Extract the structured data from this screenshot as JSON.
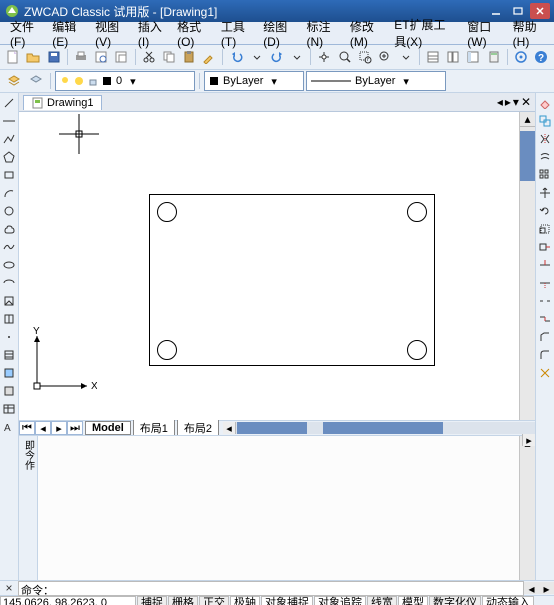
{
  "title": "ZWCAD Classic 试用版 - [Drawing1]",
  "menu": [
    "文件(F)",
    "编辑(E)",
    "视图(V)",
    "插入(I)",
    "格式(O)",
    "工具(T)",
    "绘图(D)",
    "标注(N)",
    "修改(M)",
    "ET扩展工具(X)",
    "窗口(W)",
    "帮助(H)"
  ],
  "doc_tab": "Drawing1",
  "layer_combo": "0",
  "color_combo": "ByLayer",
  "linetype_combo": "ByLayer",
  "model_tabs": {
    "active": "Model",
    "others": [
      "布局1",
      "布局2"
    ]
  },
  "cmd_prompt": "命令：",
  "coords": "145.0626,  98.2623,  0",
  "status_cells": [
    {
      "t": "捕捉",
      "on": false
    },
    {
      "t": "栅格",
      "on": false
    },
    {
      "t": "正交",
      "on": false
    },
    {
      "t": "极轴",
      "on": true
    },
    {
      "t": "对象捕捉",
      "on": true
    },
    {
      "t": "对象追踪",
      "on": true
    },
    {
      "t": "线宽",
      "on": false
    },
    {
      "t": "模型",
      "on": true
    },
    {
      "t": "数字化仪",
      "on": false
    },
    {
      "t": "动态输入",
      "on": true
    }
  ],
  "ucs": {
    "x": "X",
    "y": "Y"
  },
  "side_label": "即今作"
}
